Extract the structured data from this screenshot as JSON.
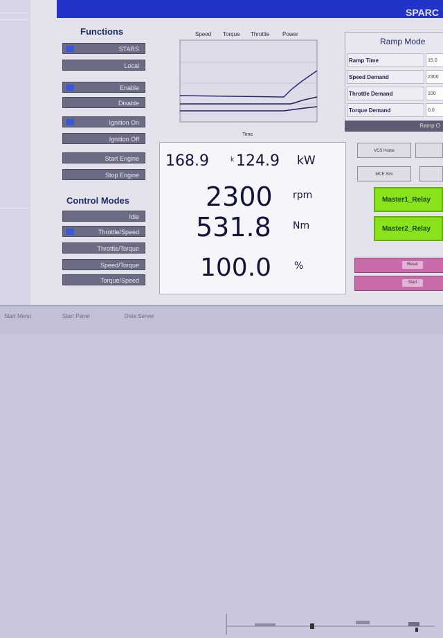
{
  "app": {
    "title": "SPARC"
  },
  "functions": {
    "title": "Functions",
    "buttons": [
      "STARS",
      "Local",
      "Enable",
      "Disable",
      "Ignition On",
      "Ignition Off",
      "Start Engine",
      "Stop Engine"
    ],
    "indicators": [
      true,
      false,
      true,
      false,
      true,
      false,
      false,
      false
    ]
  },
  "control_modes": {
    "title": "Control Modes",
    "buttons": [
      "Idle",
      "Throttle/Speed",
      "Throttle/Torque",
      "Speed/Torque",
      "Torque/Speed"
    ],
    "indicators": [
      false,
      true,
      false,
      false,
      false
    ]
  },
  "chart": {
    "legend": [
      "Speed",
      "Torque",
      "Throttle",
      "Power"
    ],
    "xlabel": "Time"
  },
  "readout": {
    "value_a": "168.9",
    "value_b_prefix": "k",
    "value_b": "124.9",
    "power_unit": "kW",
    "speed": "2300",
    "speed_unit": "rpm",
    "torque": "531.8",
    "torque_unit": "Nm",
    "throttle": "100.0",
    "throttle_unit": "%"
  },
  "ramp_mode": {
    "title": "Ramp Mode",
    "rows": [
      {
        "label": "Ramp Time",
        "value": "15.0"
      },
      {
        "label": "Speed Demand",
        "value": "2300"
      },
      {
        "label": "Throttle Demand",
        "value": "100"
      },
      {
        "label": "Torque Demand",
        "value": "0.0"
      }
    ],
    "bar_label": "Ramp O"
  },
  "buttons_right": [
    "VCS Home",
    "",
    "MCE Sim",
    ""
  ],
  "relays": [
    "Master1_Relay",
    "Master2_Relay"
  ],
  "magenta_buttons": [
    "Reset",
    "Start"
  ],
  "taskbar": [
    "Start Menu",
    "Start Panel",
    "Data Server"
  ],
  "colors": {
    "titlebar": "#2233c8",
    "relay": "#8ae21a",
    "alarm": "#c86aa8",
    "indicator": "#3b58d8"
  }
}
